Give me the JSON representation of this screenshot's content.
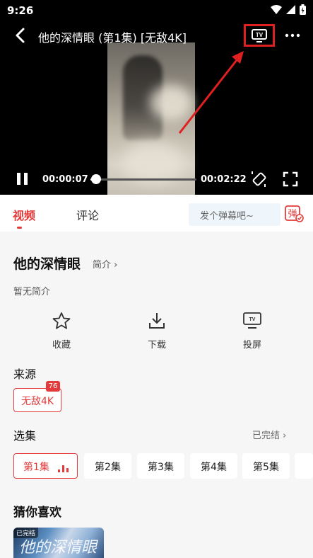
{
  "status_bar": {
    "time": "9:26"
  },
  "player": {
    "title": "他的深情眼 (第1集) [无敌4K]",
    "current_time": "00:00:07",
    "total_time": "00:02:22",
    "progress": 0.05,
    "icons": [
      "back-icon",
      "tv-cast-icon",
      "more-icon",
      "pause-icon",
      "rotate-icon",
      "fullscreen-icon"
    ],
    "highlight_color": "#e02020"
  },
  "tabs": [
    {
      "label": "视频",
      "active": true
    },
    {
      "label": "评论",
      "active": false
    }
  ],
  "danmu": {
    "placeholder": "发个弹幕吧~",
    "icon_label": "弹"
  },
  "show": {
    "title": "他的深情眼",
    "intro_link": "简介",
    "intro_text": "暂无简介"
  },
  "actions": [
    {
      "label": "收藏",
      "icon": "star-icon"
    },
    {
      "label": "下载",
      "icon": "download-icon"
    },
    {
      "label": "投屏",
      "icon": "tv-cast-icon",
      "icon_text": "TV"
    }
  ],
  "source": {
    "title": "来源",
    "chip": "无敌4K",
    "badge": "76"
  },
  "episodes": {
    "title": "选集",
    "status": "已完结",
    "items": [
      "第1集",
      "第2集",
      "第3集",
      "第4集",
      "第5集"
    ],
    "active_index": 0
  },
  "recommend": {
    "title": "猜你喜欢",
    "card_badge": "已完结",
    "card_art_text": "他的深情眼"
  },
  "colors": {
    "accent": "#e33b3b",
    "player_bg": "#000000",
    "page_bg": "#f6f6f6"
  }
}
